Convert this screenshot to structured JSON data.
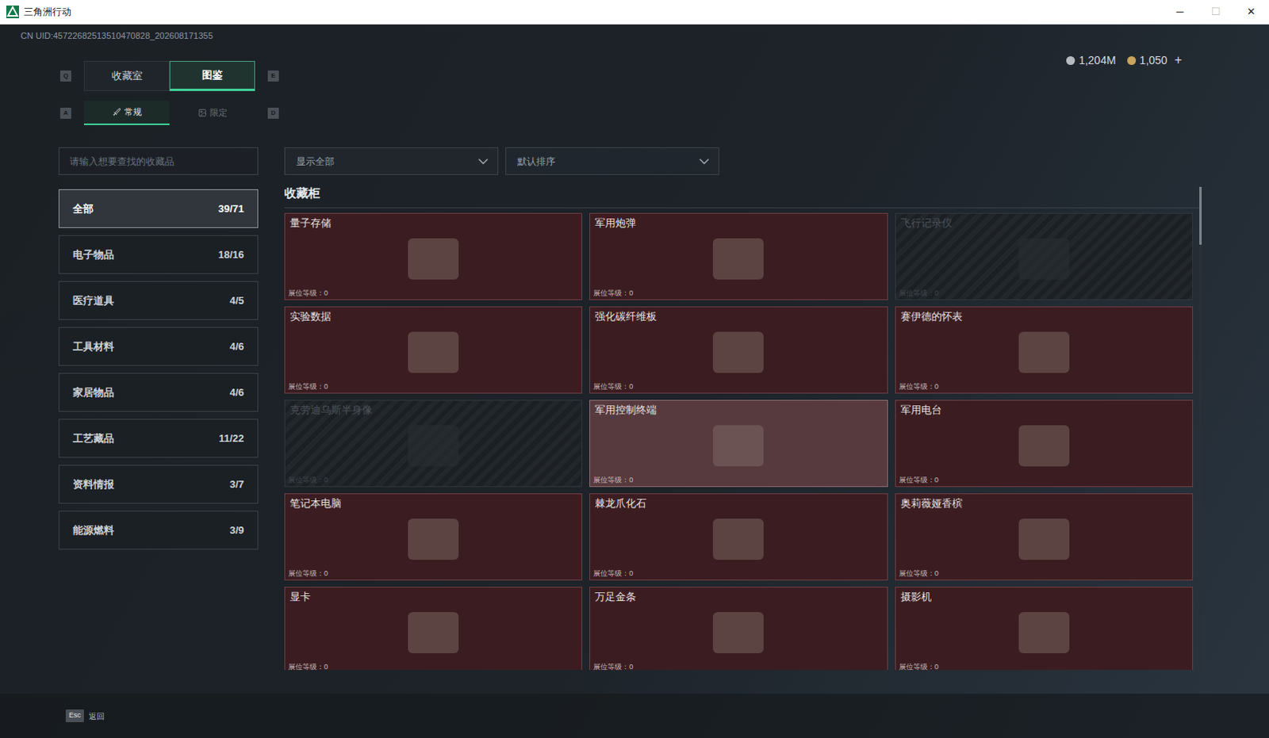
{
  "window": {
    "title": "三角洲行动",
    "controls": [
      {
        "glyph": "─",
        "disabled": false
      },
      {
        "glyph": "☐",
        "disabled": true
      },
      {
        "glyph": "✕",
        "disabled": false
      }
    ]
  },
  "uid": "CN UID:45722682513510470828_202608171355",
  "currency": [
    {
      "amount": "1,204M",
      "color": "#b8bcc0",
      "plus": ""
    },
    {
      "amount": "1,050",
      "color": "#c9a45a",
      "plus": "+"
    }
  ],
  "tabs": {
    "prev_key": "Q",
    "next_key": "E",
    "items": [
      {
        "label": "收藏室",
        "selected": false
      },
      {
        "label": "图鉴",
        "selected": true
      }
    ]
  },
  "subtabs": {
    "prev_key": "A",
    "next_key": "D",
    "items": [
      {
        "label": "常规",
        "selected": true
      },
      {
        "label": "限定",
        "selected": false
      }
    ]
  },
  "search": {
    "placeholder": "请输入想要查找的收藏品"
  },
  "filters": [
    {
      "value": "显示全部"
    },
    {
      "value": "默认排序"
    }
  ],
  "sidebar": {
    "items": [
      {
        "label": "全部",
        "count": "39/71",
        "selected": true
      },
      {
        "label": "电子物品",
        "count": "18/16",
        "selected": false
      },
      {
        "label": "医疗道具",
        "count": "4/5",
        "selected": false
      },
      {
        "label": "工具材料",
        "count": "4/6",
        "selected": false
      },
      {
        "label": "家居物品",
        "count": "4/6",
        "selected": false
      },
      {
        "label": "工艺藏品",
        "count": "11/22",
        "selected": false
      },
      {
        "label": "资料情报",
        "count": "3/7",
        "selected": false
      },
      {
        "label": "能源燃料",
        "count": "3/9",
        "selected": false
      }
    ]
  },
  "section": {
    "title": "收藏柜"
  },
  "cards": [
    {
      "name": "量子存储",
      "level": "展位等级：0",
      "locked": false,
      "highlighted": false
    },
    {
      "name": "军用炮弹",
      "level": "展位等级：0",
      "locked": false,
      "highlighted": false
    },
    {
      "name": "飞行记录仪",
      "level": "展位等级：0",
      "locked": true,
      "highlighted": false
    },
    {
      "name": "实验数据",
      "level": "展位等级：0",
      "locked": false,
      "highlighted": false
    },
    {
      "name": "强化碳纤维板",
      "level": "展位等级：0",
      "locked": false,
      "highlighted": false
    },
    {
      "name": "赛伊德的怀表",
      "level": "展位等级：0",
      "locked": false,
      "highlighted": false
    },
    {
      "name": "克劳迪乌斯半身像",
      "level": "展位等级：0",
      "locked": true,
      "highlighted": false
    },
    {
      "name": "军用控制终端",
      "level": "展位等级：0",
      "locked": false,
      "highlighted": true
    },
    {
      "name": "军用电台",
      "level": "展位等级：0",
      "locked": false,
      "highlighted": false
    },
    {
      "name": "笔记本电脑",
      "level": "展位等级：0",
      "locked": false,
      "highlighted": false
    },
    {
      "name": "棘龙爪化石",
      "level": "展位等级：0",
      "locked": false,
      "highlighted": false
    },
    {
      "name": "奥莉薇娅香槟",
      "level": "展位等级：0",
      "locked": false,
      "highlighted": false
    },
    {
      "name": "显卡",
      "level": "展位等级：0",
      "locked": false,
      "highlighted": false
    },
    {
      "name": "万足金条",
      "level": "展位等级：0",
      "locked": false,
      "highlighted": false
    },
    {
      "name": "摄影机",
      "level": "展位等级：0",
      "locked": false,
      "highlighted": false
    }
  ],
  "scrollbar": {
    "level": 0.12
  },
  "footer": {
    "key": "Esc",
    "label": "返回"
  }
}
